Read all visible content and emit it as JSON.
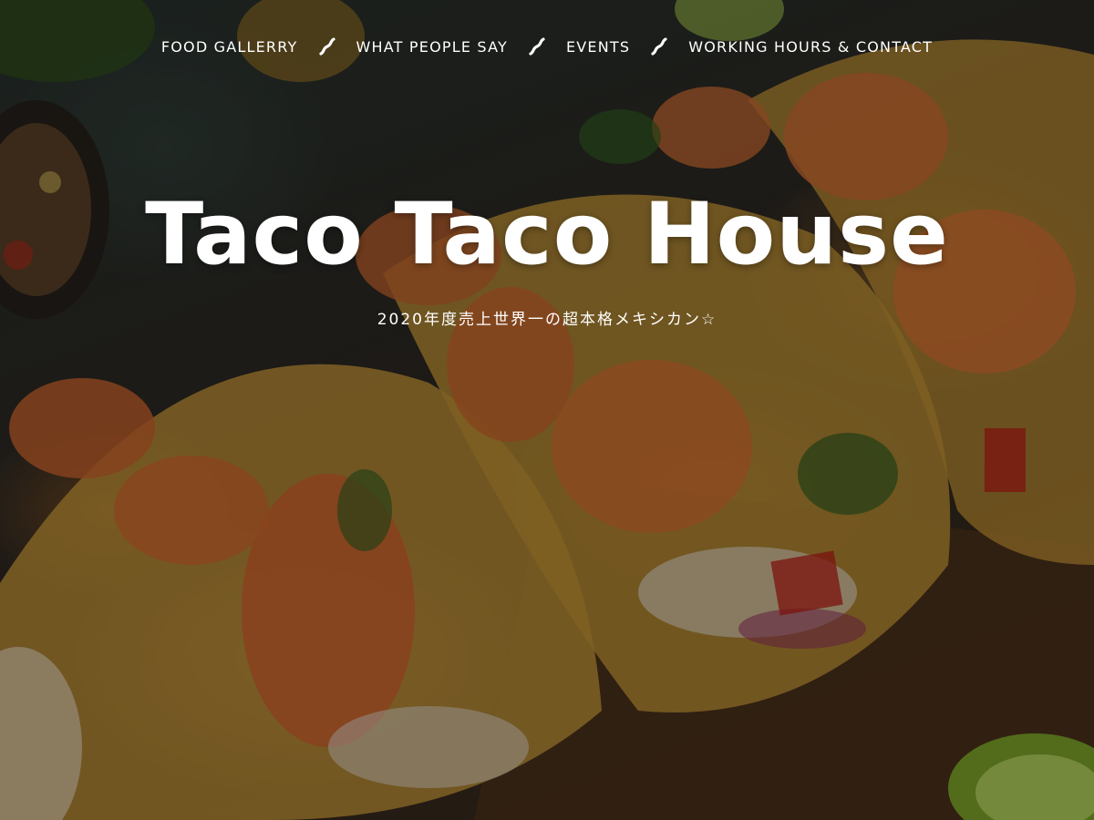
{
  "nav": {
    "items": [
      {
        "label": "FOOD GALLERRY"
      },
      {
        "label": "WHAT PEOPLE SAY"
      },
      {
        "label": "EVENTS"
      },
      {
        "label": "WORKING HOURS & CONTACT"
      }
    ],
    "separator_icon": "wavy-slash-icon"
  },
  "hero": {
    "title": "Taco Taco House",
    "tagline": "2020年度売上世界一の超本格メキシカン☆",
    "background_image": "shrimp-tacos-photo"
  },
  "colors": {
    "text": "#ffffff",
    "overlay": "rgba(0,0,0,0.30)",
    "tortilla": "#c99a3a",
    "shrimp": "#c9672e",
    "lime": "#7fae2c",
    "board": "#5a3a1e"
  }
}
